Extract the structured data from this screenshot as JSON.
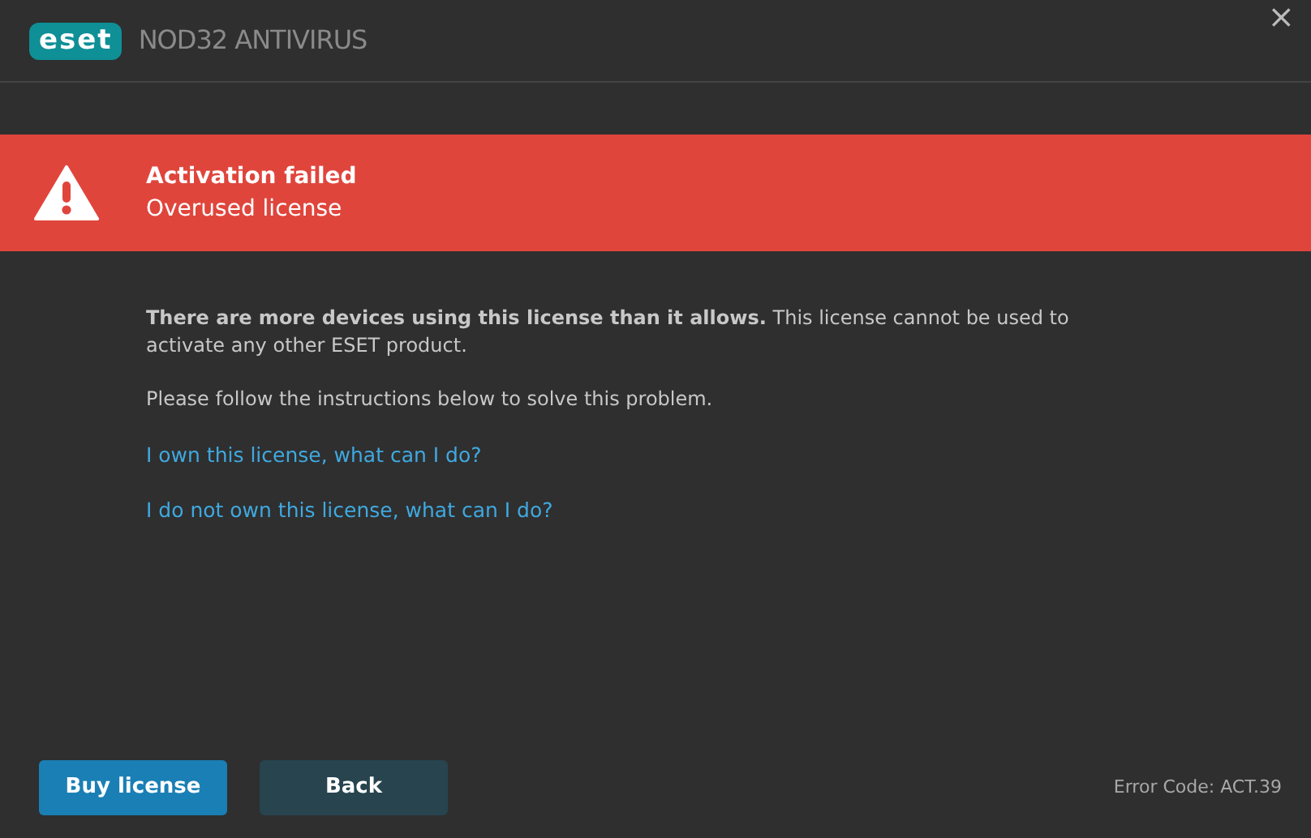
{
  "window": {
    "logo": "eset",
    "title": "NOD32 ANTIVIRUS",
    "close": "×"
  },
  "alert": {
    "title": "Activation failed",
    "subtitle": "Overused license"
  },
  "message": "**There are more devices using this license than it allows.** This license cannot be used to activate any other ESET product.",
  "instruction": "Please follow the instructions below to solve this problem.",
  "links": [
    "I own this license, what can I do?",
    "I do not own this license, what can I do?"
  ],
  "buttons": [
    {
      "label": "Buy license",
      "kind": "primary"
    },
    {
      "label": "Back",
      "kind": "secondary"
    }
  ],
  "error_code": "Error Code: ACT.39"
}
